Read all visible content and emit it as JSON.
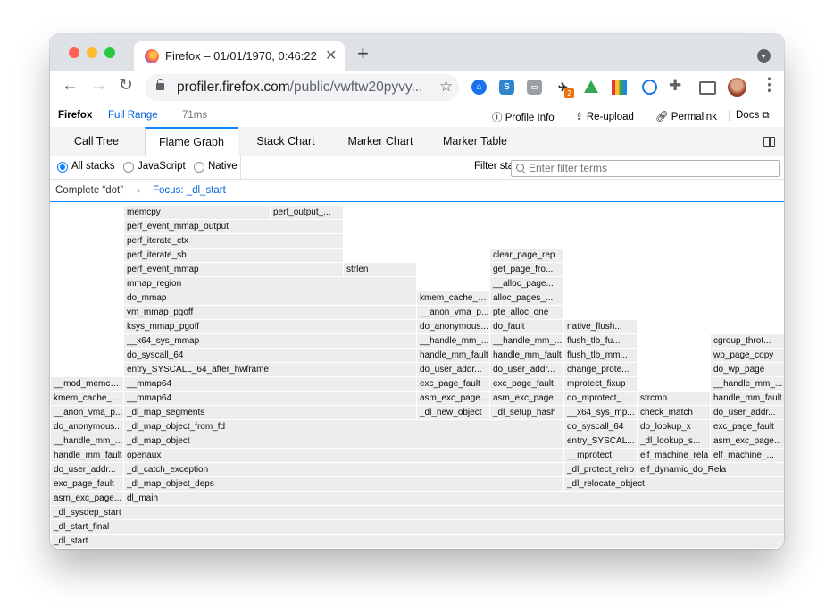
{
  "browser": {
    "tab_title": "Firefox – 01/01/1970, 0:46:22 U",
    "url_host": "profiler.firefox.com",
    "url_path": "/public/vwftw20pyvy...",
    "extension_badge": "2"
  },
  "profiler": {
    "product": "Firefox",
    "range": "Full Range",
    "duration": "71ms",
    "actions": {
      "profile_info": "Profile Info",
      "reupload": "Re-upload",
      "permalink": "Permalink",
      "docs": "Docs"
    },
    "tabs": [
      "Call Tree",
      "Flame Graph",
      "Stack Chart",
      "Marker Chart",
      "Marker Table"
    ],
    "selected_tab": "Flame Graph",
    "stack_types": [
      "All stacks",
      "JavaScript",
      "Native"
    ],
    "selected_stack_type": "All stacks",
    "filter_label": "Filter stacks:",
    "filter_placeholder": "Enter filter terms",
    "breadcrumbs": [
      "Complete “dot”",
      "Focus: _dl_start"
    ]
  },
  "flame_frames": [
    "_dl_start",
    "_dl_start_final",
    "_dl_sysdep_start",
    "asm_exc_page...",
    "dl_main",
    "exc_page_fault",
    "_dl_map_object_deps",
    "_dl_relocate_object",
    "do_user_addr...",
    "_dl_catch_exception",
    "_dl_protect_relro",
    "elf_dynamic_do_Rela",
    "handle_mm_fault",
    "openaux",
    "__mprotect",
    "elf_machine_rela",
    "elf_machine_...",
    "__handle_mm_...",
    "_dl_map_object",
    "entry_SYSCAL...",
    "_dl_lookup_s...",
    "asm_exc_page...",
    "do_anonymous...",
    "_dl_map_object_from_fd",
    "do_syscall_64",
    "do_lookup_x",
    "exc_page_fault",
    "__anon_vma_p...",
    "_dl_map_segments",
    "_dl_new_object",
    "_dl_setup_hash",
    "__x64_sys_mp...",
    "check_match",
    "do_user_addr...",
    "kmem_cache_a...",
    "__mmap64",
    "asm_exc_page...",
    "asm_exc_page...",
    "do_mprotect_...",
    "strcmp",
    "handle_mm_fault",
    "__mod_memcg_...",
    "__mmap64",
    "exc_page_fault",
    "exc_page_fault",
    "mprotect_fixup",
    "__handle_mm_...",
    "entry_SYSCALL_64_after_hwframe",
    "do_user_addr...",
    "do_user_addr...",
    "change_prote...",
    "do_wp_page",
    "do_syscall_64",
    "handle_mm_fault",
    "handle_mm_fault",
    "flush_tlb_mm...",
    "wp_page_copy",
    "__x64_sys_mmap",
    "__handle_mm_...",
    "__handle_mm_...",
    "flush_tlb_fu...",
    "cgroup_throt...",
    "ksys_mmap_pgoff",
    "do_anonymous...",
    "do_fault",
    "native_flush...",
    "vm_mmap_pgoff",
    "__anon_vma_p...",
    "pte_alloc_one",
    "do_mmap",
    "kmem_cache_a...",
    "alloc_pages_...",
    "mmap_region",
    "__alloc_page...",
    "perf_event_mmap",
    "strlen",
    "get_page_fro...",
    "perf_iterate_sb",
    "clear_page_rep",
    "perf_iterate_ctx",
    "perf_event_mmap_output",
    "memcpy",
    "perf_output_..."
  ]
}
